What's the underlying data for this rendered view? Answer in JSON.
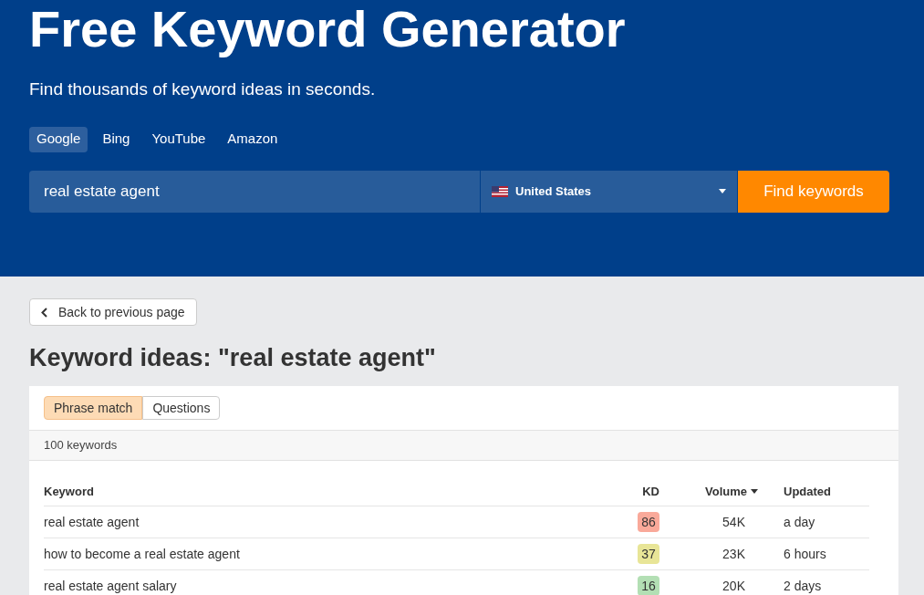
{
  "header": {
    "title": "Free Keyword Generator",
    "subtitle": "Find thousands of keyword ideas in seconds."
  },
  "engines": [
    {
      "label": "Google",
      "selected": true
    },
    {
      "label": "Bing",
      "selected": false
    },
    {
      "label": "YouTube",
      "selected": false
    },
    {
      "label": "Amazon",
      "selected": false
    }
  ],
  "search": {
    "value": "real estate agent",
    "country": "United States",
    "button": "Find keywords"
  },
  "back_button": "Back to previous page",
  "heading": "Keyword ideas: \"real estate agent\"",
  "match_tabs": [
    {
      "label": "Phrase match",
      "selected": true
    },
    {
      "label": "Questions",
      "selected": false
    }
  ],
  "count": "100 keywords",
  "table": {
    "columns": [
      "Keyword",
      "KD",
      "Volume",
      "Updated"
    ],
    "rows": [
      {
        "keyword": "real estate agent",
        "kd": "86",
        "color": "#f9a99a",
        "volume": "54K",
        "updated": "a day"
      },
      {
        "keyword": "how to become a real estate agent",
        "kd": "37",
        "color": "#e8e597",
        "volume": "23K",
        "updated": "6 hours"
      },
      {
        "keyword": "real estate agent salary",
        "kd": "16",
        "color": "#b3dfb4",
        "volume": "20K",
        "updated": "2 days"
      }
    ]
  }
}
